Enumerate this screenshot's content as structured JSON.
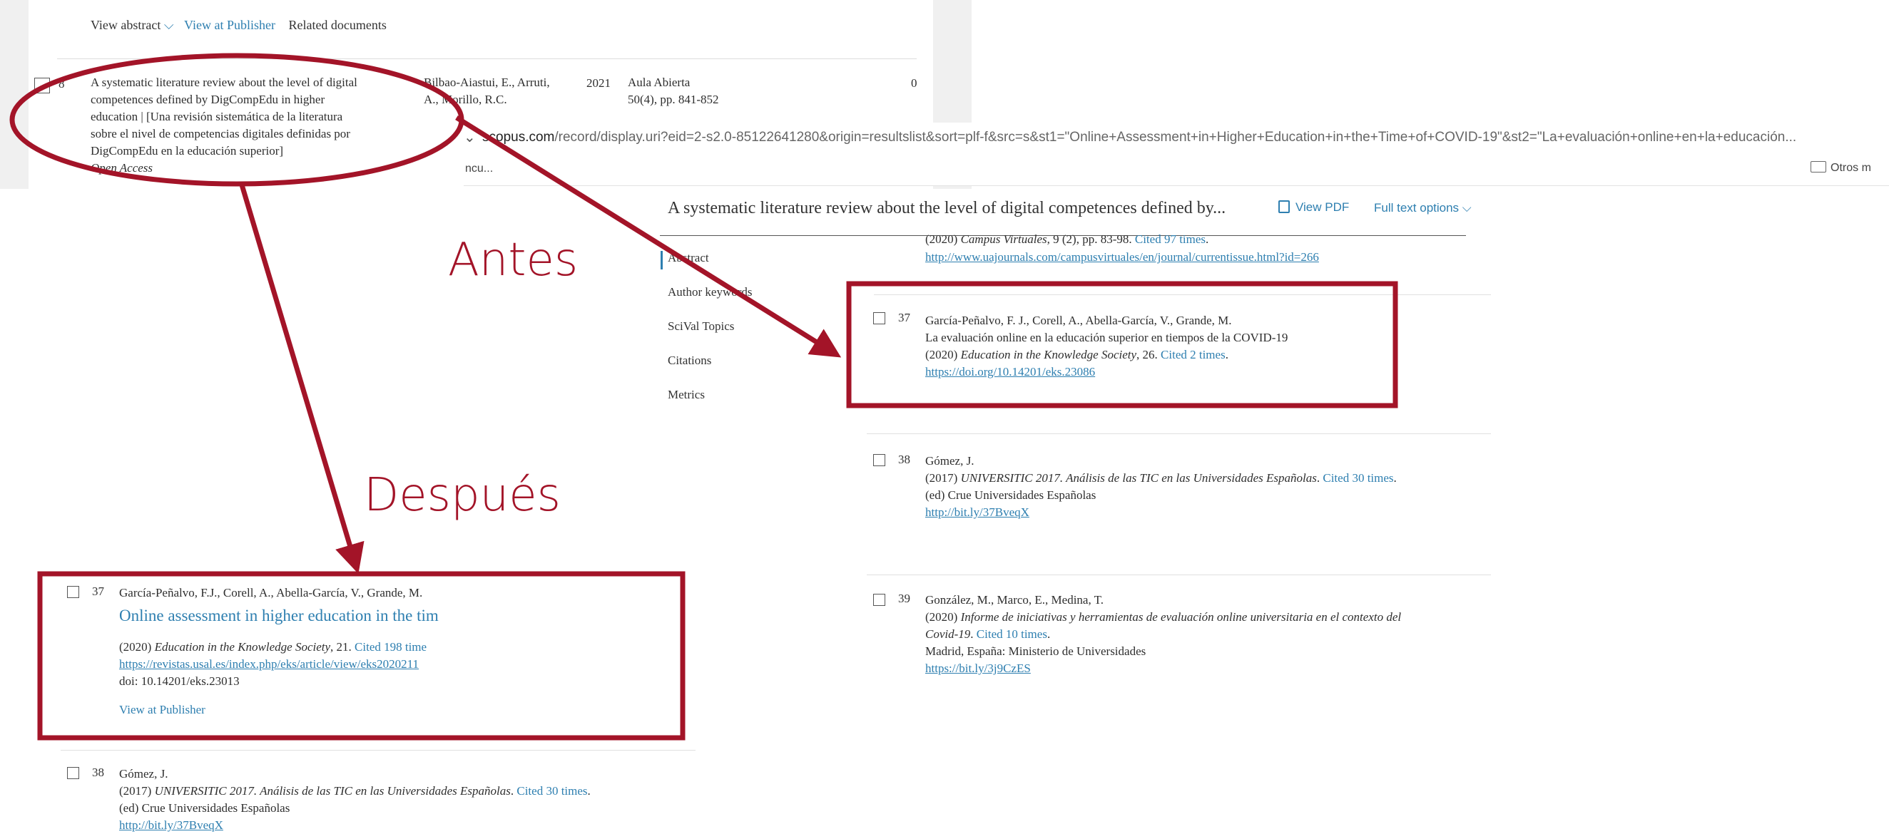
{
  "top_results": {
    "actions": {
      "view_abstract": "View abstract",
      "view_publisher": "View at Publisher",
      "related": "Related documents"
    },
    "row": {
      "index": "8",
      "title_lines": [
        "A systematic literature review about the level of digital",
        "competences defined by DigCompEdu in higher",
        "education | [Una revisión sistemática de la literatura",
        "sobre el nivel de competencias digitales definidas por",
        "DigCompEdu en la educación superior]"
      ],
      "open_access": "Open Access",
      "authors_lines": [
        "Bilbao-Aiastui, E., Arruti,",
        "A., Morillo, R.C."
      ],
      "year": "2021",
      "source_lines": [
        "Aula Abierta",
        "50(4), pp. 841-852"
      ],
      "citations": "0"
    }
  },
  "browser": {
    "url_host": "scopus.com",
    "url_path": "/record/display.uri?eid=2-s2.0-85122641280&origin=resultslist&sort=plf-f&src=s&st1=\"Online+Assessment+in+Higher+Education+in+the+Time+of+COVID-19\"&st2=\"La+evaluación+online+en+la+educación...",
    "bookmark_partial": "ncu...",
    "otros": "Otros m"
  },
  "record": {
    "title": "A systematic literature review about the level of digital competences defined by...",
    "view_pdf": "View PDF",
    "full_text": "Full text options",
    "nav": [
      "Abstract",
      "Author keywords",
      "SciVal Topics",
      "Citations",
      "Metrics"
    ],
    "prev_ref": {
      "line1_pre": "(2020) ",
      "line1_italic": "Campus Virtuales",
      "line1_post": ", 9 (2), pp. 83-98. ",
      "line1_cited": "Cited 97 times",
      "line1_end": ".",
      "url": "http://www.uajournals.com/campusvirtuales/en/journal/currentissue.html?id=266"
    },
    "ref37": {
      "num": "37",
      "authors": "García-Peñalvo, F. J., Corell, A., Abella-García, V., Grande, M.",
      "title": "La evaluación online en la educación superior en tiempos de la COVID-19",
      "src_pre": "(2020) ",
      "src_italic": "Education in the Knowledge Society",
      "src_post": ", 26. ",
      "cited": "Cited 2 times",
      "end": ".",
      "url": "https://doi.org/10.14201/eks.23086"
    },
    "ref38": {
      "num": "38",
      "authors": "Gómez, J.",
      "src_pre": "(2017) ",
      "src_italic": "UNIVERSITIC 2017. Análisis de las TIC en las Universidades Españolas",
      "src_post": ". ",
      "cited": "Cited 30 times",
      "end": ".",
      "publisher": "(ed) Crue Universidades Españolas",
      "url": "http://bit.ly/37BveqX"
    },
    "ref39": {
      "num": "39",
      "authors": "González, M., Marco, E., Medina, T.",
      "src_pre": "(2020) ",
      "src_italic_1": "Informe de iniciativas y herramientas de evaluación online universitaria en el contexto del",
      "src_italic_2": "Covid-19",
      "src_post": ". ",
      "cited": "Cited 10 times",
      "end": ".",
      "publisher": "Madrid, España: Ministerio de Universidades",
      "url": "https://bit.ly/3j9CzES"
    }
  },
  "after": {
    "ref37": {
      "num": "37",
      "authors": "García-Peñalvo, F.J., Corell, A., Abella-García, V., Grande, M.",
      "title": "Online assessment in higher education in the tim",
      "src_pre": "(2020) ",
      "src_italic": "Education in the Knowledge Society",
      "src_post": ", 21. ",
      "cited": "Cited 198 time",
      "url": "https://revistas.usal.es/index.php/eks/article/view/eks2020211",
      "doi": "doi: 10.14201/eks.23013",
      "view_publisher": "View at Publisher"
    },
    "ref38": {
      "num": "38",
      "authors": "Gómez, J.",
      "src_pre": "(2017) ",
      "src_italic": "UNIVERSITIC 2017. Análisis de las TIC en las Universidades Españolas",
      "src_post": ". ",
      "cited": "Cited 30 times",
      "end": ".",
      "publisher": "(ed) Crue Universidades Españolas",
      "url": "http://bit.ly/37BveqX"
    }
  },
  "annotations": {
    "antes": "Antes",
    "despues": "Después"
  },
  "colors": {
    "annotation": "#a31428",
    "link": "#2e7fb0"
  }
}
